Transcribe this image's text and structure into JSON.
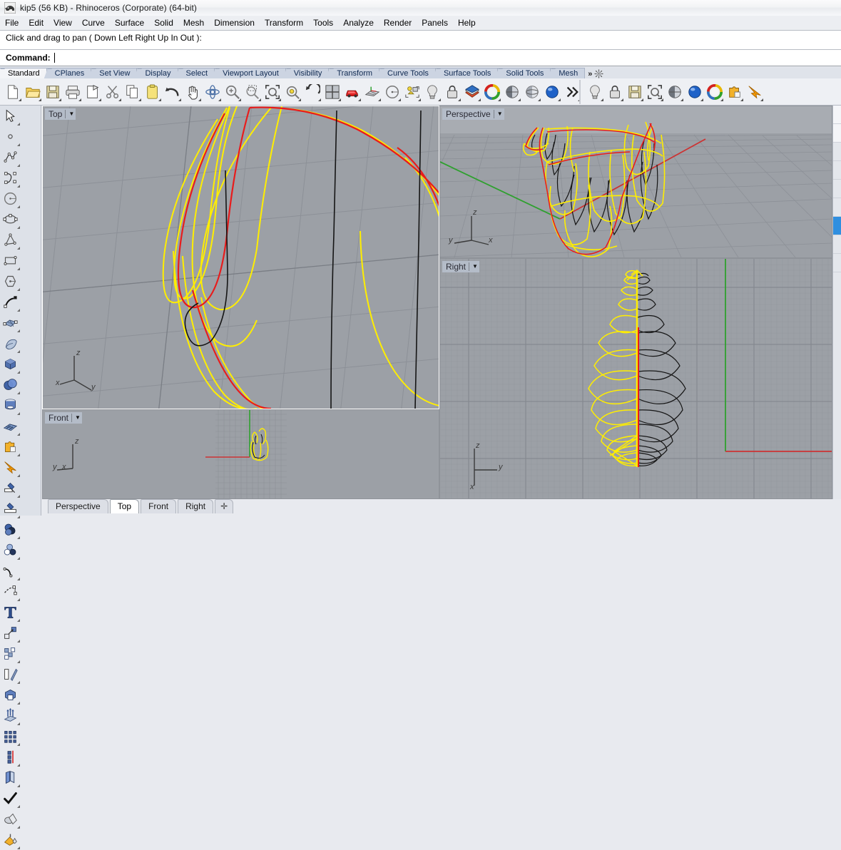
{
  "window": {
    "title": "kip5 (56 KB) - Rhinoceros (Corporate) (64-bit)",
    "app_icon": "rhino-icon"
  },
  "menu": {
    "items": [
      {
        "label": "File"
      },
      {
        "label": "Edit"
      },
      {
        "label": "View"
      },
      {
        "label": "Curve"
      },
      {
        "label": "Surface"
      },
      {
        "label": "Solid"
      },
      {
        "label": "Mesh"
      },
      {
        "label": "Dimension"
      },
      {
        "label": "Transform"
      },
      {
        "label": "Tools"
      },
      {
        "label": "Analyze"
      },
      {
        "label": "Render"
      },
      {
        "label": "Panels"
      },
      {
        "label": "Help"
      }
    ]
  },
  "prompt": {
    "history_line": "Click and drag to pan ( Down  Left  Right  Up  In  Out ):",
    "command_label": "Command:",
    "command_value": "",
    "command_placeholder": ""
  },
  "toolbar_tabs": {
    "items": [
      {
        "label": "Standard",
        "active": true
      },
      {
        "label": "CPlanes",
        "active": false
      },
      {
        "label": "Set View",
        "active": false
      },
      {
        "label": "Display",
        "active": false
      },
      {
        "label": "Select",
        "active": false
      },
      {
        "label": "Viewport Layout",
        "active": false
      },
      {
        "label": "Visibility",
        "active": false
      },
      {
        "label": "Transform",
        "active": false
      },
      {
        "label": "Curve Tools",
        "active": false
      },
      {
        "label": "Surface Tools",
        "active": false
      },
      {
        "label": "Solid Tools",
        "active": false
      },
      {
        "label": "Mesh",
        "active": false
      }
    ],
    "overflow_label": "»",
    "options_icon": "gear-icon"
  },
  "main_toolbar": {
    "left_group": [
      {
        "icon": "new-file-icon",
        "tip": "New"
      },
      {
        "icon": "open-folder-icon",
        "tip": "Open"
      },
      {
        "icon": "save-icon",
        "tip": "Save"
      },
      {
        "icon": "print-icon",
        "tip": "Print"
      },
      {
        "icon": "cut-paste-icon",
        "tip": "Cut"
      },
      {
        "icon": "scissors-icon",
        "tip": "Trim"
      },
      {
        "icon": "copy-icon",
        "tip": "Copy"
      },
      {
        "icon": "clipboard-paste-icon",
        "tip": "Paste"
      },
      {
        "icon": "undo-arrow-icon",
        "tip": "Undo"
      },
      {
        "icon": "pan-hand-icon",
        "tip": "Pan"
      },
      {
        "icon": "rotate-view-icon",
        "tip": "Rotate View"
      },
      {
        "icon": "zoom-in-icon",
        "tip": "Zoom In"
      },
      {
        "icon": "zoom-window-icon",
        "tip": "Zoom Window"
      },
      {
        "icon": "zoom-extents-icon",
        "tip": "Zoom Extents"
      },
      {
        "icon": "zoom-selected-icon",
        "tip": "Zoom Selected"
      },
      {
        "icon": "undo-view-icon",
        "tip": "Undo View Change"
      },
      {
        "icon": "four-viewport-icon",
        "tip": "Viewport Layout"
      },
      {
        "icon": "render-car-icon",
        "tip": "Render"
      },
      {
        "icon": "cplane-grid-icon",
        "tip": "Set CPlane"
      },
      {
        "icon": "circle-icon",
        "tip": "Circle"
      },
      {
        "icon": "group-objects-icon",
        "tip": "Group"
      },
      {
        "icon": "lightbulb-icon",
        "tip": "Lights"
      },
      {
        "icon": "lock-icon",
        "tip": "Lock"
      },
      {
        "icon": "layers-icon",
        "tip": "Layers"
      },
      {
        "icon": "color-wheel-icon",
        "tip": "Object Color"
      },
      {
        "icon": "shade-sphere-icon",
        "tip": "Shaded"
      },
      {
        "icon": "ghosted-sphere-icon",
        "tip": "Ghosted"
      },
      {
        "icon": "render-sphere-icon",
        "tip": "Rendered"
      },
      {
        "icon": "overflow-chevron-icon",
        "tip": "More"
      }
    ],
    "right_group": [
      {
        "icon": "lightbulb-icon",
        "tip": "Lights"
      },
      {
        "icon": "lock-icon",
        "tip": "Lock"
      },
      {
        "icon": "save-icon",
        "tip": "Save"
      },
      {
        "icon": "zoom-extents-icon",
        "tip": "Zoom Extents"
      },
      {
        "icon": "shade-sphere-icon",
        "tip": "Shaded"
      },
      {
        "icon": "render-sphere-icon",
        "tip": "Rendered"
      },
      {
        "icon": "color-wheel-icon",
        "tip": "Color"
      },
      {
        "icon": "puzzle-icon",
        "tip": "Plug-ins"
      },
      {
        "icon": "orange-arrow-icon",
        "tip": "Explode"
      }
    ]
  },
  "sidebar": {
    "items": [
      {
        "icon": "select-arrow-icon"
      },
      {
        "icon": "point-icon"
      },
      {
        "icon": "polyline-icon"
      },
      {
        "icon": "control-point-curve-icon"
      },
      {
        "icon": "circle-icon"
      },
      {
        "icon": "ellipse-icon"
      },
      {
        "icon": "arc-icon"
      },
      {
        "icon": "rectangle-icon"
      },
      {
        "icon": "polygon-icon"
      },
      {
        "icon": "curve-blend-icon"
      },
      {
        "icon": "surface-patch-icon"
      },
      {
        "icon": "surface-sweep-icon"
      },
      {
        "icon": "box-icon"
      },
      {
        "icon": "sphere-boolean-icon"
      },
      {
        "icon": "cylinder-icon"
      },
      {
        "icon": "mesh-plane-icon"
      },
      {
        "icon": "puzzle-icon"
      },
      {
        "icon": "orange-arrow-icon"
      },
      {
        "icon": "trim-icon"
      },
      {
        "icon": "split-icon"
      },
      {
        "icon": "boolean-union-icon"
      },
      {
        "icon": "boolean-circles-icon"
      },
      {
        "icon": "fillet-curve-icon"
      },
      {
        "icon": "blend-curve-icon"
      },
      {
        "icon": "text-tool-icon"
      },
      {
        "icon": "scale-icon"
      },
      {
        "icon": "group-icon"
      },
      {
        "icon": "mirror-icon"
      },
      {
        "icon": "box-hole-icon"
      },
      {
        "icon": "extrude-icon"
      },
      {
        "icon": "array-rect-icon"
      },
      {
        "icon": "array-linear-icon"
      },
      {
        "icon": "offset-surface-icon"
      },
      {
        "icon": "check-icon"
      },
      {
        "icon": "boolean-solid-icon"
      },
      {
        "icon": "paint-bucket-icon"
      }
    ]
  },
  "viewports": [
    {
      "name": "top",
      "label": "Top",
      "active": true,
      "axes": {
        "labels": [
          "x",
          "y",
          "z"
        ]
      },
      "background": "#9ca0a6",
      "grid": "perspective-rotated",
      "content_description": "Zoomed-in NURBS curves: yellow selected curves, one red curve, black curves"
    },
    {
      "name": "perspective",
      "label": "Perspective",
      "active": false,
      "axes": {
        "labels": [
          "y",
          "x",
          "z"
        ]
      },
      "background": "#9ca0a6",
      "grid": "perspective-floor",
      "content_description": "Wireframe chicken model, yellow selected profile curves with black section curves, red X axis and green Y axis"
    },
    {
      "name": "right",
      "label": "Right",
      "active": false,
      "axes": {
        "labels": [
          "y",
          "z",
          "x"
        ]
      },
      "background": "#9ca0a6",
      "grid": "orthographic-fine",
      "content_description": "Side view: symmetric yellow and black loop curves around a vertical red-yellow axis; green vertical and red horizontal world axes at right"
    },
    {
      "name": "front",
      "label": "Front",
      "active": false,
      "axes": {
        "labels": [
          "y",
          "x",
          "z"
        ]
      },
      "background": "#9ca0a6",
      "grid": "orthographic-small",
      "content_description": "Zoomed-out front view with small yellow and black model near origin, green Z axis and red X axis"
    }
  ],
  "bottom_tabs": {
    "items": [
      {
        "label": "Perspective",
        "active": false
      },
      {
        "label": "Top",
        "active": true
      },
      {
        "label": "Front",
        "active": false
      },
      {
        "label": "Right",
        "active": false
      }
    ],
    "add_label": "✛"
  },
  "colors": {
    "viewport_bg": "#9ca0a6",
    "grid_line": "#8d9198",
    "grid_major": "#7c8087",
    "selected_curve": "#ffee00",
    "curve_red": "#e81c1c",
    "curve_black": "#111111",
    "axis_x_red": "#cc3333",
    "axis_y_green": "#2fa02f",
    "toolbar_bg": "#eef0f4",
    "tab_active": "#f3f4f7",
    "panel_highlight": "#2f8fe0"
  }
}
